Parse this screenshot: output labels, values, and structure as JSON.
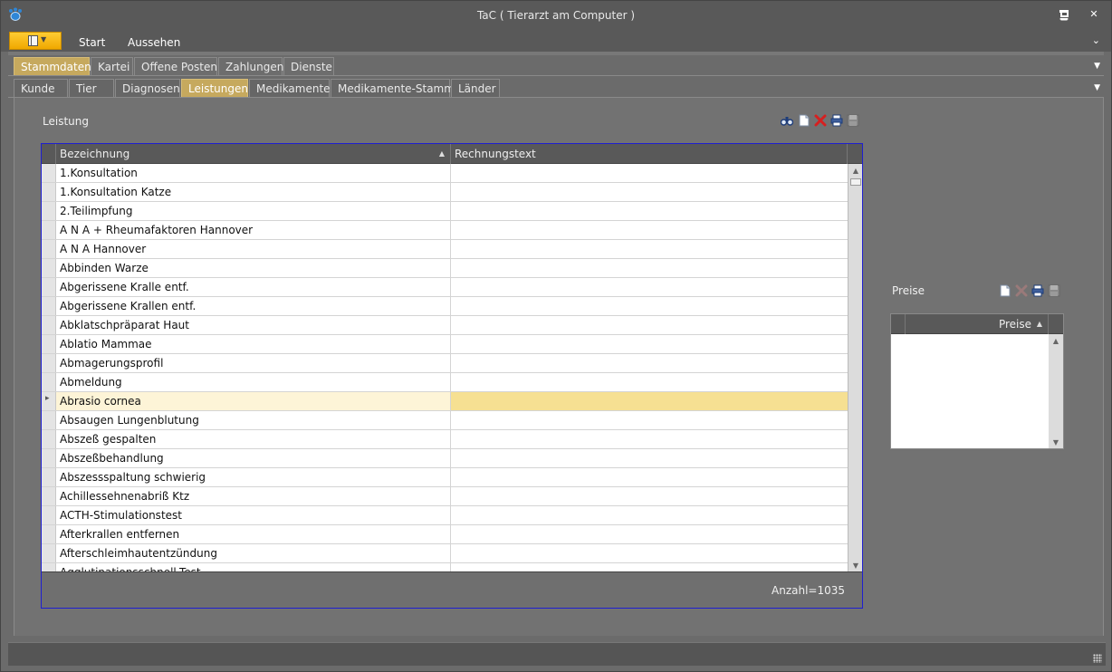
{
  "window": {
    "title": "TaC ( Tierarzt am Computer )"
  },
  "menu": {
    "items": [
      "Start",
      "Aussehen"
    ]
  },
  "tabs_primary": [
    "Stammdaten",
    "Kartei",
    "Offene Posten",
    "Zahlungen",
    "Dienste"
  ],
  "tabs_primary_active": "Stammdaten",
  "tabs_secondary": [
    "Kunde",
    "Tier",
    "Diagnosen",
    "Leistungen",
    "Medikamente",
    "Medikamente-Stamm",
    "Länder"
  ],
  "tabs_secondary_active": "Leistungen",
  "leistung": {
    "label": "Leistung",
    "toolbar_icons": [
      "binoculars-icon",
      "new-document-icon",
      "delete-icon",
      "print-icon",
      "save-icon"
    ],
    "columns": [
      "Bezeichnung",
      "Rechnungstext"
    ],
    "rows": [
      "1.Konsultation",
      "1.Konsultation Katze",
      "2.Teilimpfung",
      "A N A + Rheumafaktoren Hannover",
      "A N A Hannover",
      "Abbinden Warze",
      "Abgerissene Kralle entf.",
      "Abgerissene Krallen entf.",
      "Abklatschpräparat Haut",
      "Ablatio Mammae",
      "Abmagerungsprofil",
      "Abmeldung",
      "Abrasio cornea",
      "Absaugen Lungenblutung",
      "Abszeß gespalten",
      "Abszeßbehandlung",
      "Abszessspaltung schwierig",
      "Achillessehnenabriß Ktz",
      "ACTH-Stimulationstest",
      "Afterkrallen entfernen",
      "Afterschleimhautentzündung",
      "Agglutinationsschnell-Test"
    ],
    "selected_row": "Abrasio cornea",
    "count": "Anzahl=1035"
  },
  "preise": {
    "label": "Preise",
    "toolbar_icons": [
      "new-document-icon",
      "delete-icon",
      "print-icon",
      "save-icon"
    ],
    "columns": [
      "Preise"
    ]
  },
  "colors": {
    "accent_tab": "#c6a95e",
    "selected_row": "#f6e092",
    "grid_border": "#1f1fd0",
    "app_button": "#f0a800"
  }
}
